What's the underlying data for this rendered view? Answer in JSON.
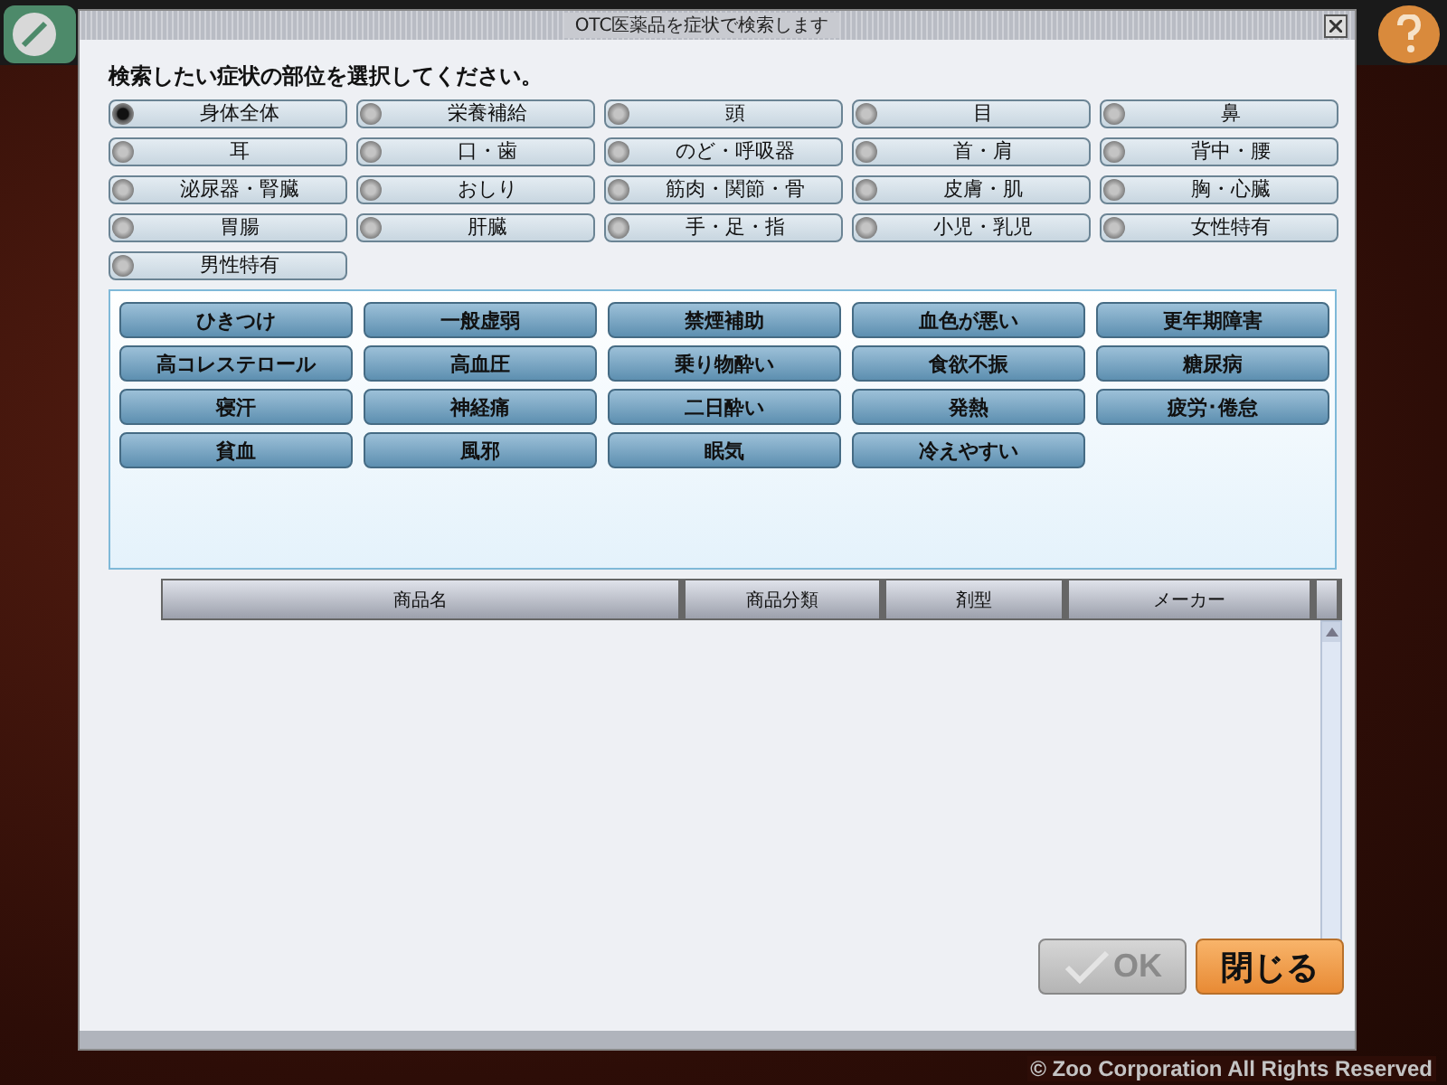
{
  "dialog": {
    "title": "OTC医薬品を症状で検索します",
    "prompt": "検索したい症状の部位を選択してください。"
  },
  "body_parts": [
    {
      "label": "身体全体",
      "selected": true
    },
    {
      "label": "栄養補給",
      "selected": false
    },
    {
      "label": "頭",
      "selected": false
    },
    {
      "label": "目",
      "selected": false
    },
    {
      "label": "鼻",
      "selected": false
    },
    {
      "label": "耳",
      "selected": false
    },
    {
      "label": "口・歯",
      "selected": false
    },
    {
      "label": "のど・呼吸器",
      "selected": false
    },
    {
      "label": "首・肩",
      "selected": false
    },
    {
      "label": "背中・腰",
      "selected": false
    },
    {
      "label": "泌尿器・腎臓",
      "selected": false
    },
    {
      "label": "おしり",
      "selected": false
    },
    {
      "label": "筋肉・関節・骨",
      "selected": false
    },
    {
      "label": "皮膚・肌",
      "selected": false
    },
    {
      "label": "胸・心臓",
      "selected": false
    },
    {
      "label": "胃腸",
      "selected": false
    },
    {
      "label": "肝臓",
      "selected": false
    },
    {
      "label": "手・足・指",
      "selected": false
    },
    {
      "label": "小児・乳児",
      "selected": false
    },
    {
      "label": "女性特有",
      "selected": false
    },
    {
      "label": "男性特有",
      "selected": false
    }
  ],
  "symptoms": [
    "ひきつけ",
    "一般虚弱",
    "禁煙補助",
    "血色が悪い",
    "更年期障害",
    "高コレステロール",
    "高血圧",
    "乗り物酔い",
    "食欲不振",
    "糖尿病",
    "寝汗",
    "神経痛",
    "二日酔い",
    "発熱",
    "疲労･倦怠",
    "貧血",
    "風邪",
    "眠気",
    "冷えやすい"
  ],
  "table": {
    "columns": [
      "商品名",
      "商品分類",
      "剤型",
      "メーカー"
    ]
  },
  "buttons": [
    {
      "kind": "ok",
      "label": "OK",
      "disabled": true
    },
    {
      "kind": "close",
      "label": "閉じる",
      "disabled": false
    }
  ],
  "footer": "© Zoo Corporation All Rights Reserved"
}
